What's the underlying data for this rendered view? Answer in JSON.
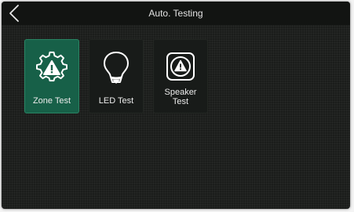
{
  "header": {
    "title": "Auto. Testing",
    "back_icon": "chevron-left-icon"
  },
  "tiles": [
    {
      "label": "Zone Test",
      "icon": "gear-warning-icon",
      "selected": true
    },
    {
      "label": "LED Test",
      "icon": "bulb-icon",
      "selected": false
    },
    {
      "label_line1": "Speaker",
      "label_line2": "Test",
      "icon": "speaker-warning-icon",
      "selected": false
    }
  ],
  "colors": {
    "background": "#1b1d1b",
    "header": "#121412",
    "selected_tile": "#176048",
    "icon_stroke": "#ffffff",
    "text": "#e2e2e2"
  }
}
